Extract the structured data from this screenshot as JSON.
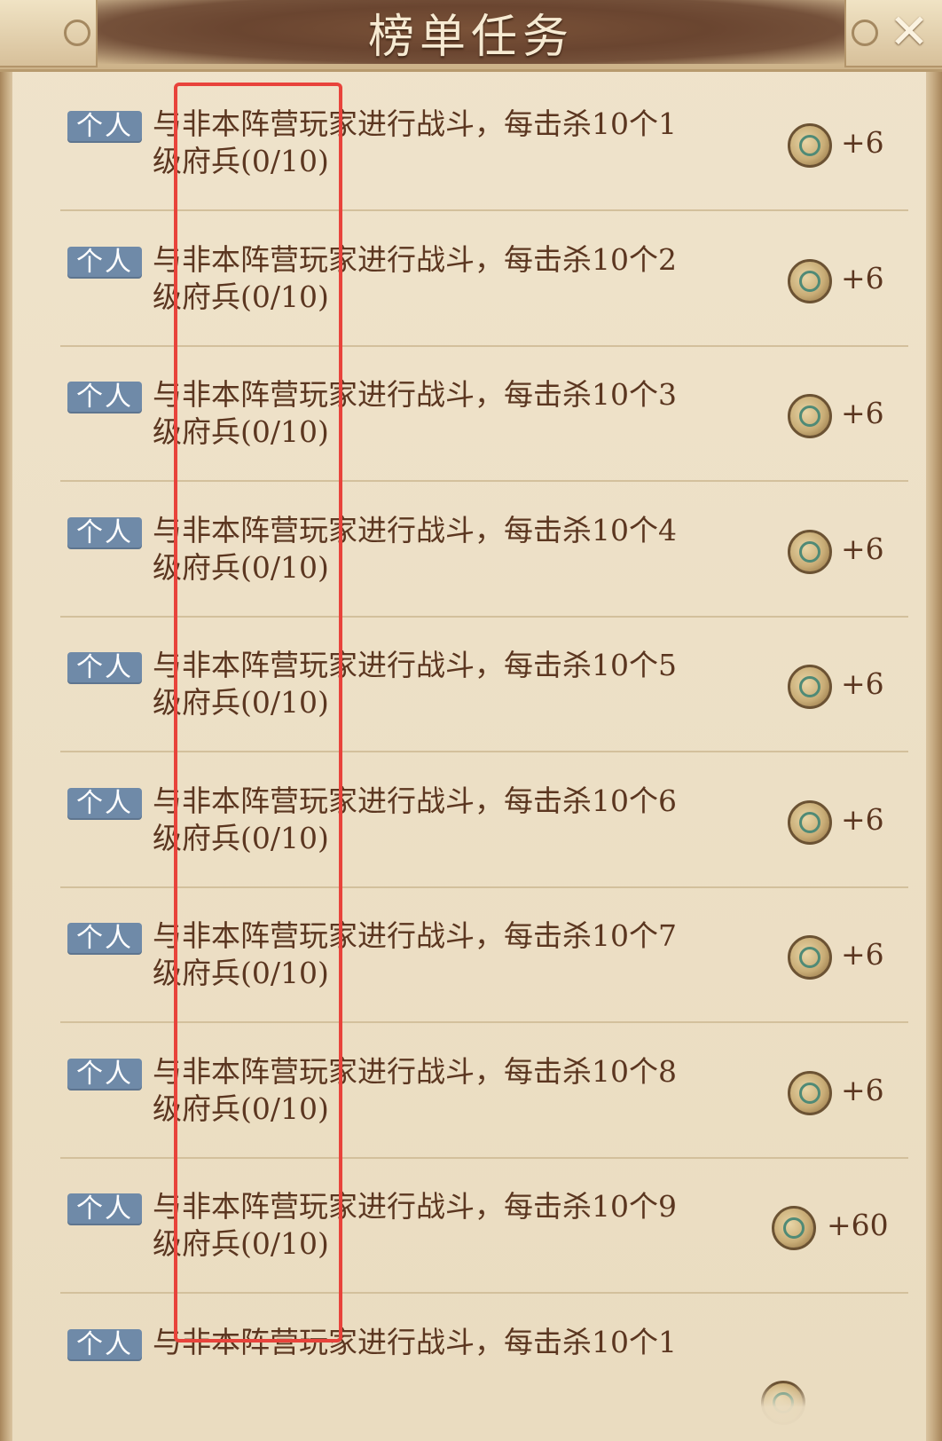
{
  "header": {
    "title": "榜单任务",
    "close_icon": "close-icon"
  },
  "tasks": [
    {
      "tag": "个人",
      "line1": "与非本阵营玩家进行战斗，每击杀10个1",
      "line2": "级府兵(0/10)",
      "reward": "+6",
      "icon": "coin-icon"
    },
    {
      "tag": "个人",
      "line1": "与非本阵营玩家进行战斗，每击杀10个2",
      "line2": "级府兵(0/10)",
      "reward": "+6",
      "icon": "coin-icon"
    },
    {
      "tag": "个人",
      "line1": "与非本阵营玩家进行战斗，每击杀10个3",
      "line2": "级府兵(0/10)",
      "reward": "+6",
      "icon": "coin-icon"
    },
    {
      "tag": "个人",
      "line1": "与非本阵营玩家进行战斗，每击杀10个4",
      "line2": "级府兵(0/10)",
      "reward": "+6",
      "icon": "coin-icon"
    },
    {
      "tag": "个人",
      "line1": "与非本阵营玩家进行战斗，每击杀10个5",
      "line2": "级府兵(0/10)",
      "reward": "+6",
      "icon": "coin-icon"
    },
    {
      "tag": "个人",
      "line1": "与非本阵营玩家进行战斗，每击杀10个6",
      "line2": "级府兵(0/10)",
      "reward": "+6",
      "icon": "coin-icon"
    },
    {
      "tag": "个人",
      "line1": "与非本阵营玩家进行战斗，每击杀10个7",
      "line2": "级府兵(0/10)",
      "reward": "+6",
      "icon": "coin-icon"
    },
    {
      "tag": "个人",
      "line1": "与非本阵营玩家进行战斗，每击杀10个8",
      "line2": "级府兵(0/10)",
      "reward": "+6",
      "icon": "coin-icon"
    },
    {
      "tag": "个人",
      "line1": "与非本阵营玩家进行战斗，每击杀10个9",
      "line2": "级府兵(0/10)",
      "reward": "+60",
      "icon": "coin-icon"
    },
    {
      "tag": "个人",
      "line1": "与非本阵营玩家进行战斗，每击杀10个1",
      "line2": "",
      "reward": "",
      "icon": "coin-icon"
    }
  ],
  "colors": {
    "highlight": "#e8433b",
    "tag_bg": "#6f8aa8",
    "text": "#5b3620",
    "title_banner": "#6a4530"
  }
}
